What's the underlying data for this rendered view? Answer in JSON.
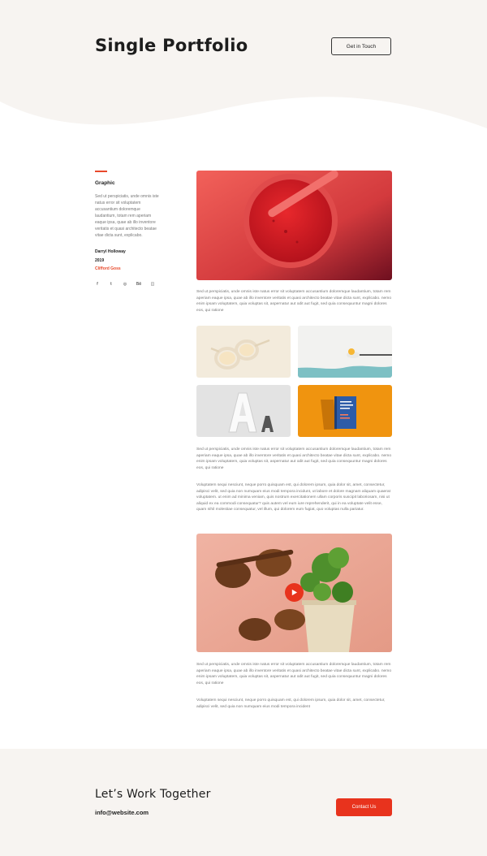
{
  "header": {
    "title": "Single Portfolio",
    "cta_label": "Get in Touch"
  },
  "sidebar": {
    "category": "Graphic",
    "description": "Sed ut perspiciatis, unde omnis iste natus error sit voluptatem accusantium doloremque laudantium, totam rem aperiam eaque ipsa, quae ab illo inventore veritatis et quasi architecto beatae vitae dicta sunt, explicabo.",
    "author": "Darryl Holloway",
    "year": "2019",
    "client": "Clifford Goss",
    "socials": [
      {
        "icon": "facebook-icon",
        "glyph": "f"
      },
      {
        "icon": "twitter-icon",
        "glyph": "t"
      },
      {
        "icon": "dribbble-icon",
        "glyph": "◎"
      },
      {
        "icon": "behance-icon",
        "glyph": "Bē"
      },
      {
        "icon": "instagram-icon",
        "glyph": "◫"
      }
    ]
  },
  "content": {
    "para1": "Sed ut perspiciatis, unde omnis iste natus error sit voluptatem accusantium doloremque laudantium, totam rem aperiam eaque ipsa, quae ab illo inventore veritatis et quasi architecto beatae vitae dicta sunt, explicabo. nemo enim ipsam voluptatem, quia voluptas sit, aspernatur aut odit aut fugit, sed quia consequuntur magni dolores eos, qui ratione",
    "para2": "Sed ut perspiciatis, unde omnis iste natus error sit voluptatem accusantium doloremque laudantium, totam rem aperiam eaque ipsa, quae ab illo inventore veritatis et quasi architecto beatae vitae dicta sunt, explicabo. nemo enim ipsam voluptatem, quia voluptas sit, aspernatur aut odit aut fugit, sed quia consequuntur magni dolores eos, qui ratione",
    "para3": "Voluptatem sequi nesciunt, neque porro quisquam est, qui dolorem ipsum, quia dolor sit, amet, consectetur, adipisci velit, sed quia non numquam eius modi tempora incidunt, ut labore et dolore magnam aliquam quaerat voluptatem. ut enim ad minima veniam, quis nostrum exercitationem ullam corporis suscipit laboriosam, nisi ut aliquid ex ea commodi consequatur? quis autem vel eum iure reprehenderit, qui in ea voluptate velit esse, quam nihil molestiae consequatur, vel illum, qui dolorem eum fugiat, quo voluptas nulla pariatur.",
    "para4": "Sed ut perspiciatis, unde omnis iste natus error sit voluptatem accusantium doloremque laudantium, totam rem aperiam eaque ipsa, quae ab illo inventore veritatis et quasi architecto beatae vitae dicta sunt, explicabo. nemo enim ipsam voluptatem, quia voluptas sit, aspernatur aut odit aut fugit, sed quia consequuntur magni dolores eos, qui ratione",
    "para5": "Voluptatem sequi nesciunt, neque porro quisquam est, qui dolorem ipsum, quia dolor sit, amet, consectetur, adipisci velit, sed quia non numquam eius modi tempora incident"
  },
  "footer": {
    "title": "Let’s Work Together",
    "email": "info@website.com",
    "cta_label": "Contact Us"
  },
  "colors": {
    "accent": "#e8331d",
    "background_alt": "#f7f4f1",
    "text_dark": "#1d1d1d",
    "text_muted": "#777777"
  }
}
